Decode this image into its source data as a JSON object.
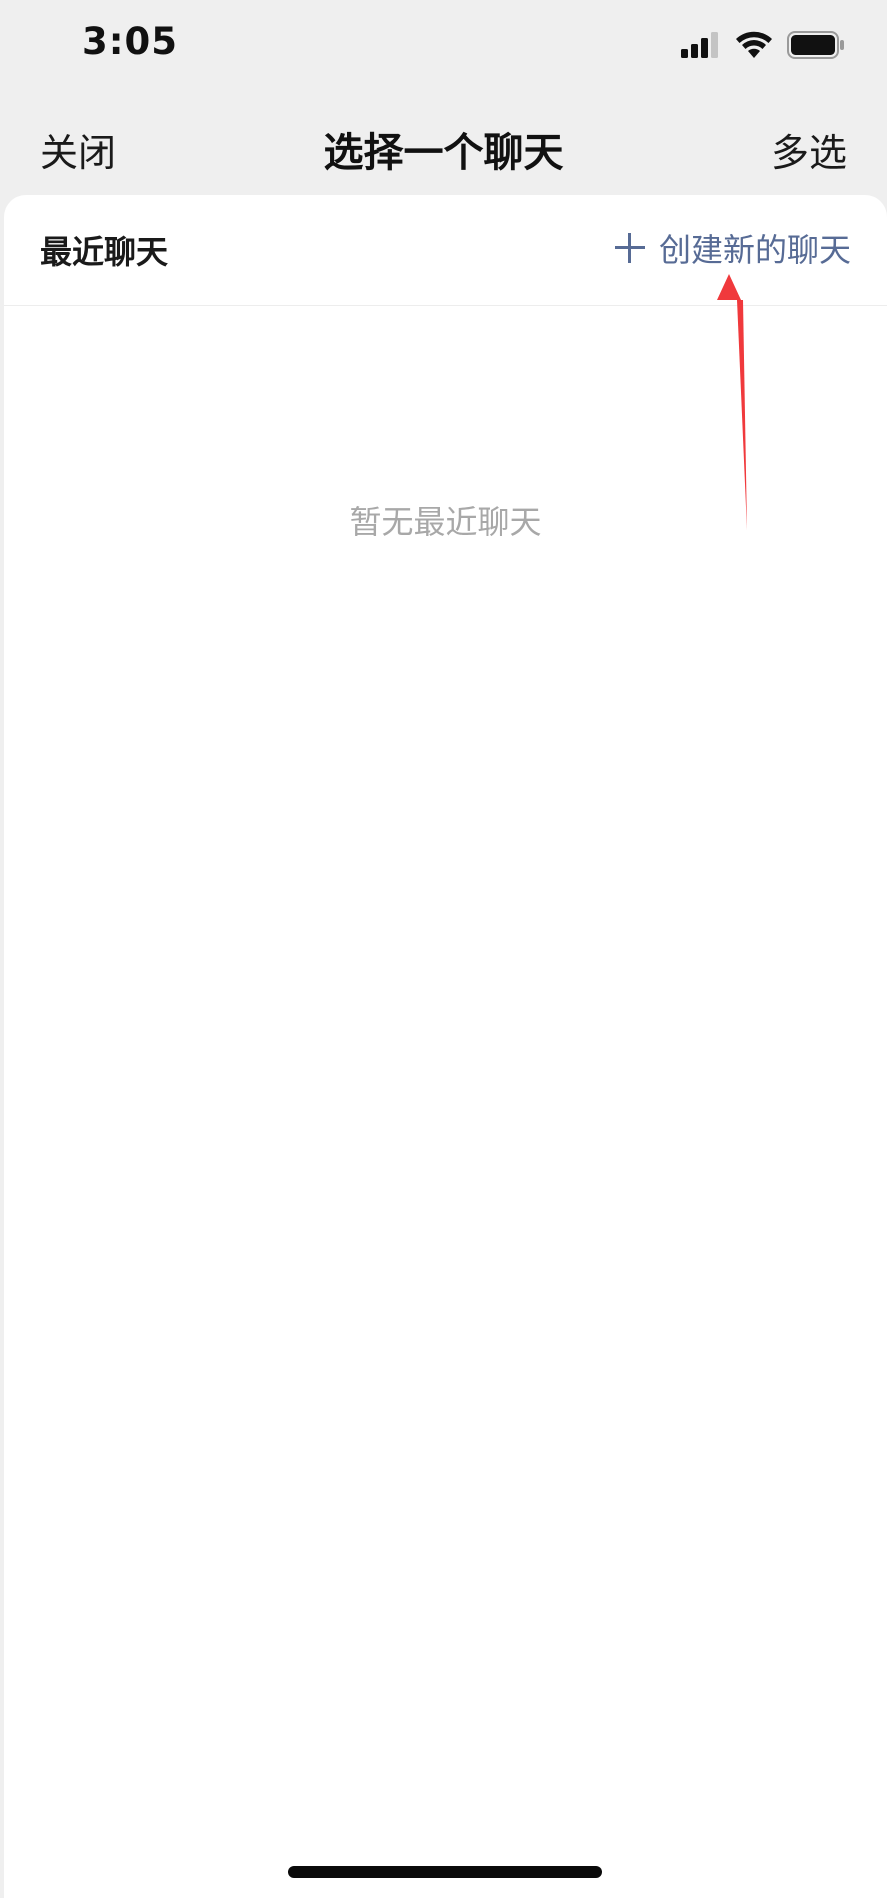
{
  "status_bar": {
    "time": "3:05",
    "icons": [
      "signal-icon",
      "wifi-icon",
      "battery-icon"
    ]
  },
  "nav": {
    "close_label": "关闭",
    "title": "选择一个聊天",
    "multi_select_label": "多选"
  },
  "section": {
    "title": "最近聊天",
    "create_new_label": "创建新的聊天",
    "create_new_icon": "plus-icon"
  },
  "empty_state": {
    "text": "暂无最近聊天"
  },
  "colors": {
    "link": "#576B95",
    "annotation": "#F0393C",
    "background": "#EFEFEF",
    "sheet": "#FFFFFF"
  }
}
